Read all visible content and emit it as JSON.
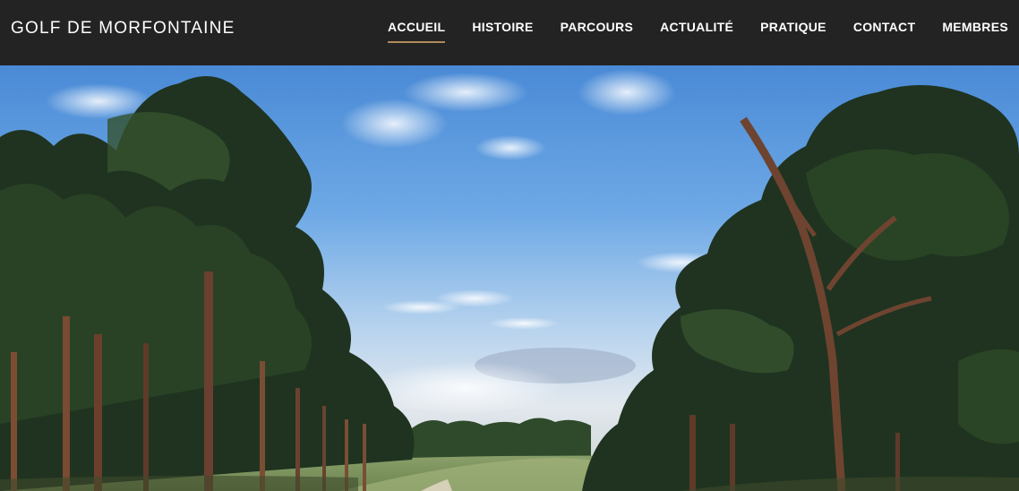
{
  "header": {
    "brand": "GOLF DE MORFONTAINE",
    "nav": [
      {
        "label": "ACCUEIL",
        "active": true
      },
      {
        "label": "HISTOIRE",
        "active": false
      },
      {
        "label": "PARCOURS",
        "active": false
      },
      {
        "label": "ACTUALITÉ",
        "active": false
      },
      {
        "label": "PRATIQUE",
        "active": false
      },
      {
        "label": "CONTACT",
        "active": false
      },
      {
        "label": "MEMBRES",
        "active": false
      }
    ]
  },
  "colors": {
    "header_bg": "#232323",
    "active_underline": "#b08a5a",
    "text": "#ffffff"
  }
}
